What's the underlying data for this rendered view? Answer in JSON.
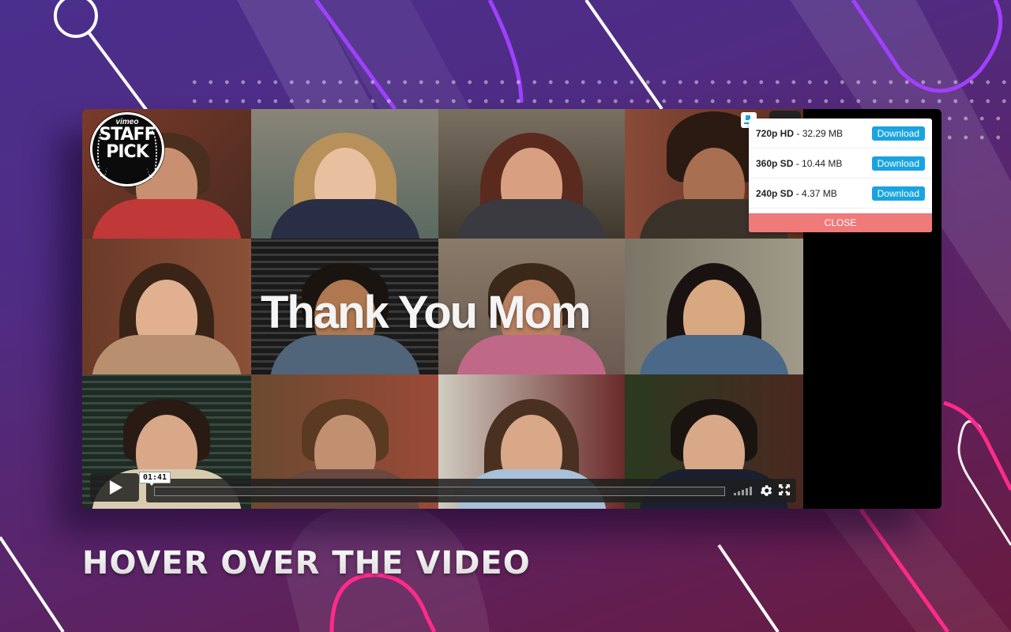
{
  "colors": {
    "accent_blue": "#1aa3e0",
    "close_red": "#f07a7a",
    "bg_purple": "#4a2f8c",
    "bg_maroon": "#6a1a3e",
    "line_violet": "#a040ff",
    "line_pink": "#ff2a8a"
  },
  "video": {
    "title_overlay": "Thank You Mom",
    "badge": {
      "brand": "vimeo",
      "line1": "STAFF",
      "line2": "PICK"
    },
    "controls": {
      "play_icon": "play-icon",
      "time_tooltip": "01:41",
      "progress_fraction": 0.0,
      "volume_icon": "volume-bars-icon",
      "settings_icon": "gear-icon",
      "fullscreen_icon": "fullscreen-icon"
    }
  },
  "download_popup": {
    "options": [
      {
        "quality": "720p HD",
        "size": " - 32.29 MB",
        "button": "Download"
      },
      {
        "quality": "360p SD",
        "size": " - 10.44 MB",
        "button": "Download"
      },
      {
        "quality": "240p SD",
        "size": " - 4.37 MB",
        "button": "Download"
      }
    ],
    "close_label": "CLOSE"
  },
  "headline": "HOVER OVER THE VIDEO"
}
